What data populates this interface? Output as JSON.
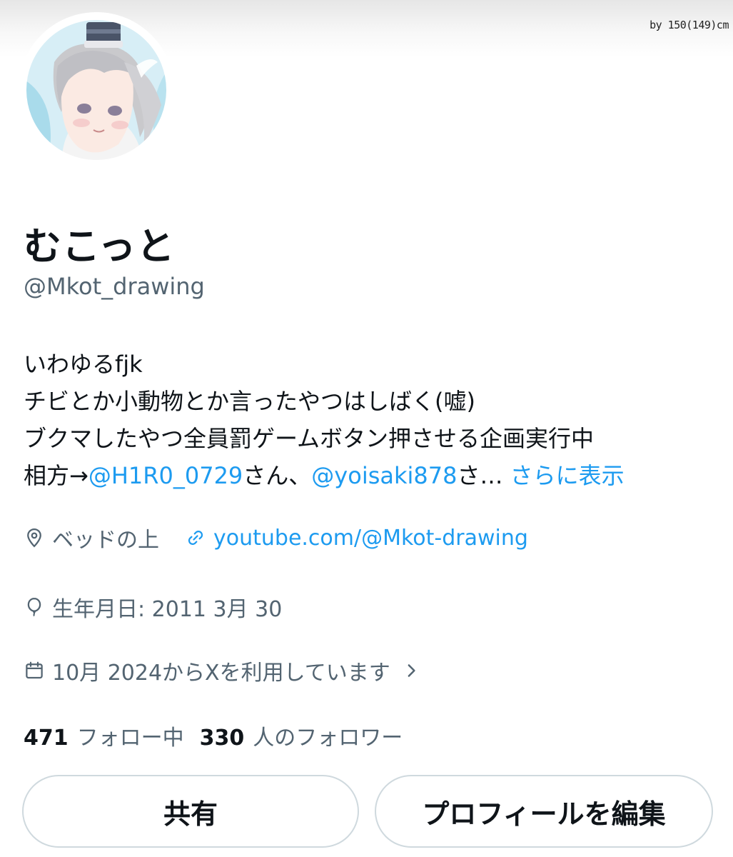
{
  "banner": {
    "credit": "by 150(149)cm"
  },
  "profile": {
    "display_name": "むこっと",
    "handle": "@Mkot_drawing"
  },
  "bio": {
    "line1": "いわゆるfjk",
    "line2": "チビとか小動物とか言ったやつはしばく(嘘)",
    "line3": "ブクマしたやつ全員罰ゲームボタン押させる企画実行中",
    "line4_prefix": "相方→",
    "mention1": "@H1R0_0729",
    "mention1_suffix": "さん、",
    "mention2": "@yoisaki878",
    "mention2_suffix": "さ…",
    "show_more": "さらに表示"
  },
  "meta": {
    "location": "ベッドの上",
    "website": "youtube.com/@Mkot-drawing",
    "birthday": "生年月日: 2011 3月 30",
    "joined": "10月 2024からXを利用しています"
  },
  "stats": {
    "following_count": "471",
    "following_label": "フォロー中",
    "followers_count": "330",
    "followers_label": "人のフォロワー"
  },
  "buttons": {
    "share": "共有",
    "edit_profile": "プロフィールを編集"
  },
  "colors": {
    "link": "#1d9bf0",
    "secondary_text": "#536471",
    "primary_text": "#0f1419",
    "button_border": "#cfd9de"
  },
  "icons": {
    "location": "map-pin-icon",
    "website": "link-icon",
    "birthday": "balloon-icon",
    "joined": "calendar-icon",
    "joined_more": "chevron-right-icon"
  }
}
